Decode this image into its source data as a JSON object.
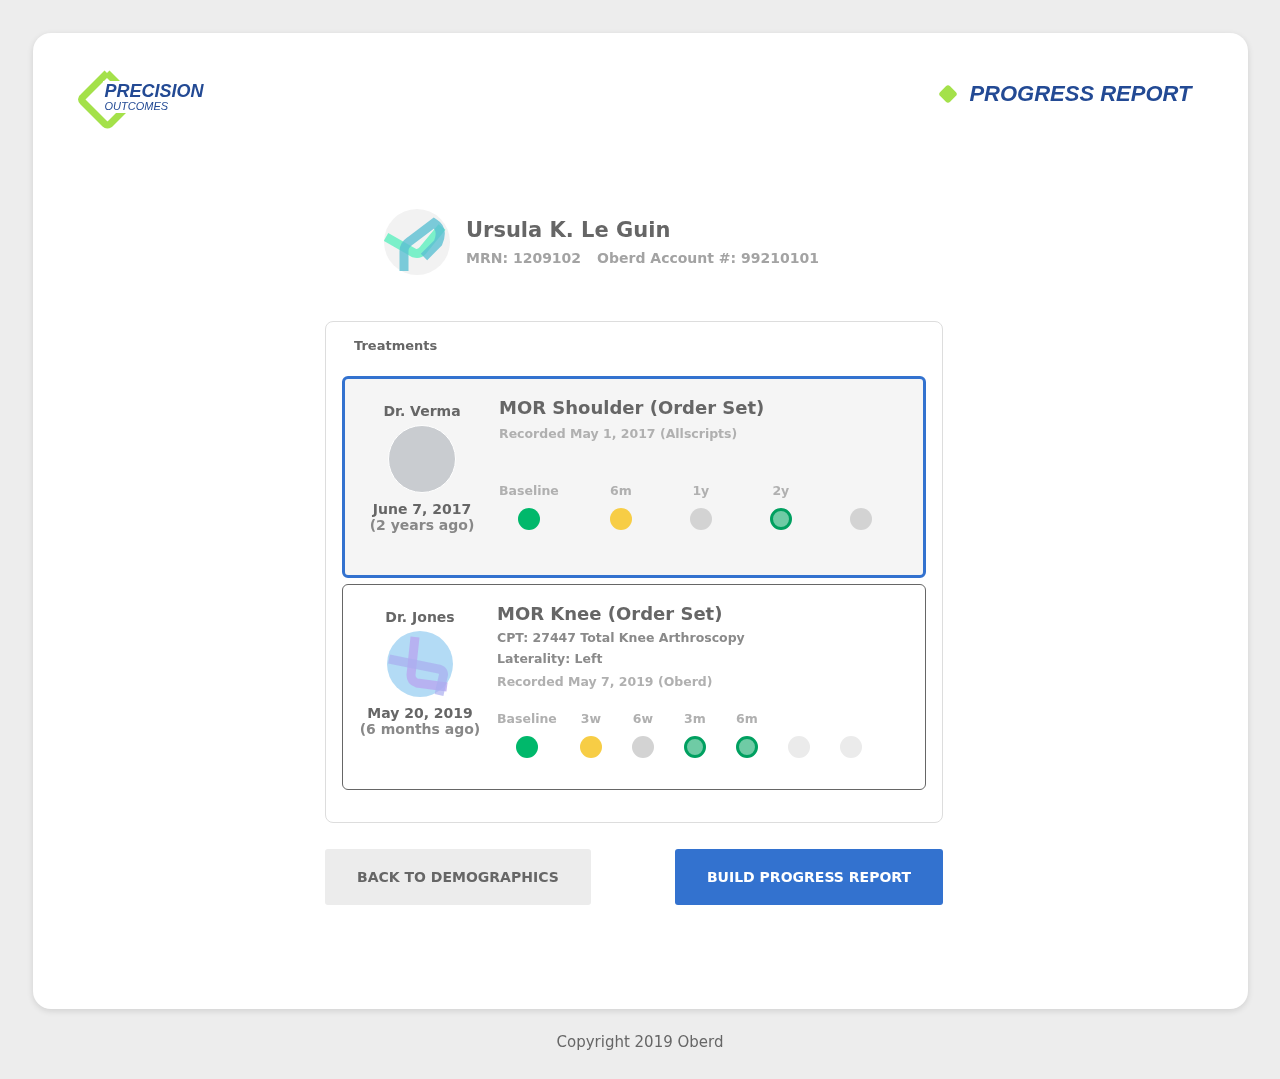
{
  "logo": {
    "line_1": "PRECISION",
    "line_2": "OUTCOMES"
  },
  "page_title": "PROGRESS REPORT",
  "patient": {
    "name": "Ursula K. Le Guin",
    "mrn": "MRN: 1209102",
    "account": "Oberd Account #: 99210101"
  },
  "treatments_panel": {
    "title": "Treatments",
    "treatments": [
      {
        "selected": true,
        "doctor": "Dr. Verma",
        "avatar": {
          "kind": "photo"
        },
        "date": "June 7, 2017",
        "ago": "(2 years ago)",
        "title": "MOR Shoulder (Order Set)",
        "recorded": "Recorded May 1, 2017 (Allscripts)",
        "milestones": [
          {
            "label": "Baseline",
            "kind": "complete"
          },
          {
            "label": "6m",
            "kind": "partial"
          },
          {
            "label": "1y",
            "kind": "missed"
          },
          {
            "label": "2y",
            "kind": "scored"
          },
          {
            "kind": "missed"
          }
        ]
      },
      {
        "selected": false,
        "doctor": "Dr. Jones",
        "avatar": {
          "kind": "logo"
        },
        "date": "May 20, 2019",
        "ago": "(6 months ago)",
        "title": "MOR Knee (Order Set)",
        "details": [
          "CPT: 27447 Total Knee Arthroscopy",
          "Laterality: Left"
        ],
        "recorded": "Recorded May 7, 2019 (Oberd)",
        "milestones": [
          {
            "label": "Baseline",
            "kind": "complete"
          },
          {
            "label": "3w",
            "kind": "partial"
          },
          {
            "label": "6w",
            "kind": "missed"
          },
          {
            "label": "3m",
            "kind": "scored"
          },
          {
            "label": "6m",
            "kind": "scored"
          },
          {
            "kind": "future"
          },
          {
            "kind": "future"
          }
        ]
      }
    ]
  },
  "buttons": {
    "back": "BACK TO DEMOGRAPHICS",
    "build": "BUILD PROGRESS REPORT"
  },
  "footer": "Copyright 2019 Oberd"
}
